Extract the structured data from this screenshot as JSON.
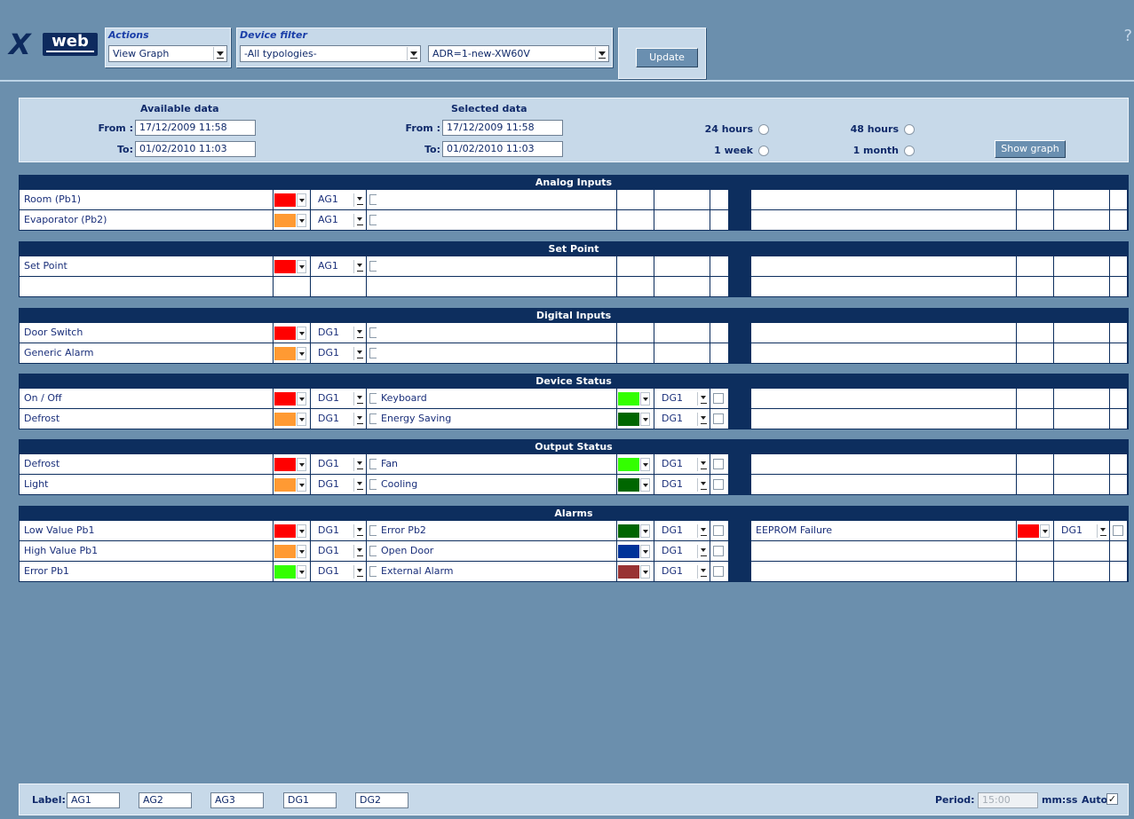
{
  "logo": {
    "x": "X",
    "web": "web"
  },
  "help": "?",
  "actions": {
    "label": "Actions",
    "value": "View Graph"
  },
  "device_filter": {
    "label": "Device filter",
    "typology": "-All typologies-",
    "device": "ADR=1-new-XW60V"
  },
  "update_label": "Update",
  "available": {
    "title": "Available data",
    "from_label": "From :",
    "from": "17/12/2009 11:58",
    "to_label": "To:",
    "to": "01/02/2010 11:03"
  },
  "selected": {
    "title": "Selected data",
    "from_label": "From :",
    "from": "17/12/2009 11:58",
    "to_label": "To:",
    "to": "01/02/2010 11:03"
  },
  "ranges": {
    "h24": "24 hours",
    "h48": "48 hours",
    "week": "1 week",
    "month": "1 month"
  },
  "show_graph": "Show graph",
  "colors": {
    "red": "#ff0000",
    "orange": "#ff9a33",
    "green": "#33ff00",
    "dark_green": "#006600",
    "blue": "#003399",
    "brown": "#993333"
  },
  "groups": [
    {
      "title": "Analog Inputs",
      "rows": [
        [
          {
            "label": "Room (Pb1)",
            "color": "#ff0000",
            "axis": "AG1"
          },
          null,
          null
        ],
        [
          {
            "label": "Evaporator (Pb2)",
            "color": "#ff9a33",
            "axis": "AG1"
          },
          null,
          null
        ]
      ]
    },
    {
      "title": "Set Point",
      "rows": [
        [
          {
            "label": "Set Point",
            "color": "#ff0000",
            "axis": "AG1"
          },
          null,
          null
        ],
        [
          null,
          null,
          null
        ]
      ]
    },
    {
      "title": "Digital Inputs",
      "rows": [
        [
          {
            "label": "Door Switch",
            "color": "#ff0000",
            "axis": "DG1"
          },
          null,
          null
        ],
        [
          {
            "label": "Generic Alarm",
            "color": "#ff9a33",
            "axis": "DG1"
          },
          null,
          null
        ]
      ]
    },
    {
      "title": "Device Status",
      "rows": [
        [
          {
            "label": "On / Off",
            "color": "#ff0000",
            "axis": "DG1"
          },
          {
            "label": "Keyboard",
            "color": "#33ff00",
            "axis": "DG1"
          },
          null
        ],
        [
          {
            "label": "Defrost",
            "color": "#ff9a33",
            "axis": "DG1"
          },
          {
            "label": "Energy Saving",
            "color": "#006600",
            "axis": "DG1"
          },
          null
        ]
      ]
    },
    {
      "title": "Output Status",
      "rows": [
        [
          {
            "label": "Defrost",
            "color": "#ff0000",
            "axis": "DG1"
          },
          {
            "label": "Fan",
            "color": "#33ff00",
            "axis": "DG1"
          },
          null
        ],
        [
          {
            "label": "Light",
            "color": "#ff9a33",
            "axis": "DG1"
          },
          {
            "label": "Cooling",
            "color": "#006600",
            "axis": "DG1"
          },
          null
        ]
      ]
    },
    {
      "title": "Alarms",
      "rows": [
        [
          {
            "label": "Low Value Pb1",
            "color": "#ff0000",
            "axis": "DG1"
          },
          {
            "label": "Error Pb2",
            "color": "#006600",
            "axis": "DG1"
          },
          {
            "label": "EEPROM Failure",
            "color": "#ff0000",
            "axis": "DG1"
          }
        ],
        [
          {
            "label": "High Value Pb1",
            "color": "#ff9a33",
            "axis": "DG1"
          },
          {
            "label": "Open Door",
            "color": "#003399",
            "axis": "DG1"
          },
          null
        ],
        [
          {
            "label": "Error Pb1",
            "color": "#33ff00",
            "axis": "DG1"
          },
          {
            "label": "External Alarm",
            "color": "#993333",
            "axis": "DG1"
          },
          null
        ]
      ]
    }
  ],
  "footer": {
    "label": "Label:",
    "labels": [
      "AG1",
      "AG2",
      "AG3",
      "DG1",
      "DG2"
    ],
    "period_label": "Period:",
    "period": "15:00",
    "unit": "mm:ss",
    "auto": "Auto",
    "auto_check": "✓"
  }
}
